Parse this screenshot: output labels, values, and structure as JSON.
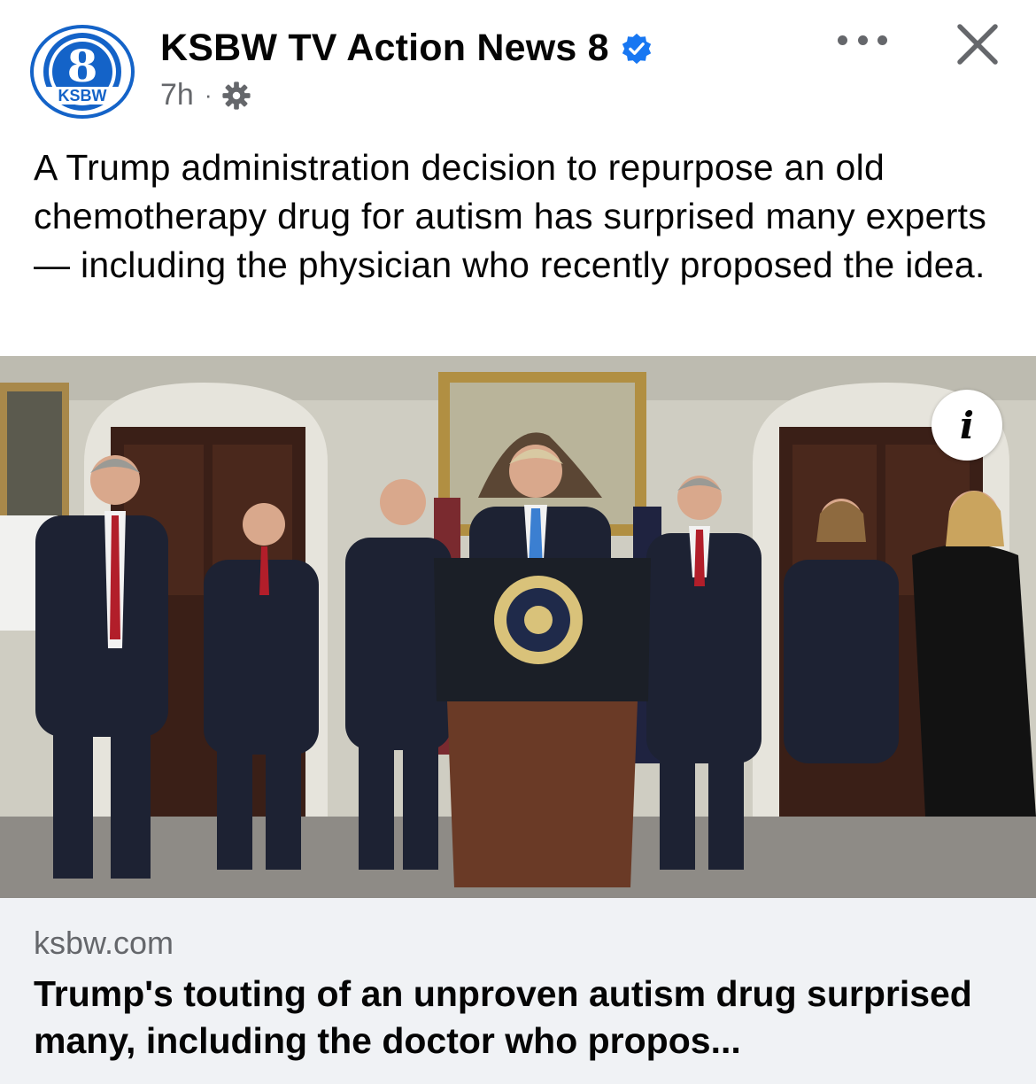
{
  "post": {
    "page_name": "KSBW TV Action News 8",
    "logo_number": "8",
    "logo_text": "KSBW",
    "time": "7h",
    "separator": "·",
    "caption": "A Trump administration decision to repurpose an old chemotherapy drug for autism has surprised many experts — including the physician who recently proposed the idea.",
    "icons": {
      "verified": "verified-badge-icon",
      "audience": "gear-icon",
      "more": "more-options-icon",
      "close": "close-icon",
      "info": "info-icon"
    },
    "info_glyph": "i"
  },
  "link": {
    "domain": "ksbw.com",
    "title": "Trump's touting of an unproven autism drug surprised many, including the doctor who propos..."
  },
  "colors": {
    "verified_blue": "#1877f2",
    "logo_blue": "#1463c8",
    "meta_gray": "#65676b",
    "card_bg": "#f0f2f5"
  }
}
